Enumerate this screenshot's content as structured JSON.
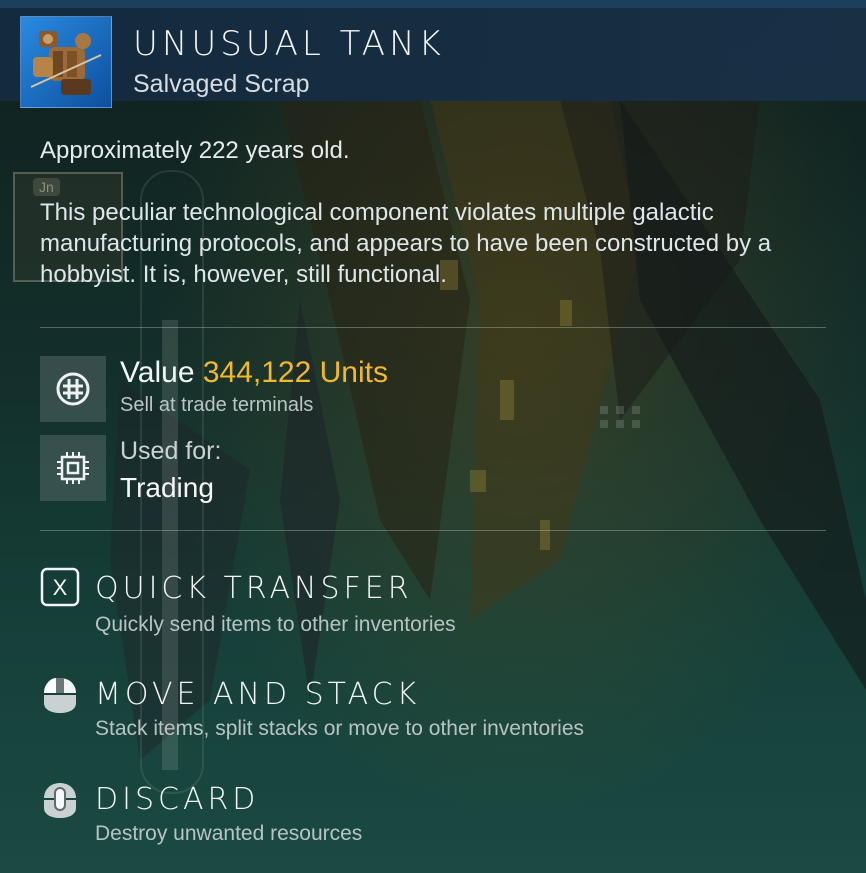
{
  "item": {
    "title": "UNUSUAL TANK",
    "subtitle": "Salvaged Scrap",
    "icon": "salvaged-tank-icon"
  },
  "description": {
    "age_prefix": "Approximately ",
    "age_value": "222",
    "age_suffix": " years old.",
    "text": "This peculiar technological component violates multiple galactic manufacturing protocols, and appears to have been constructed by a hobbyist. It is, however, still functional."
  },
  "value": {
    "label": "Value",
    "amount": "344,122 Units",
    "sub": "Sell at trade terminals",
    "icon": "units-currency-icon"
  },
  "used_for": {
    "label": "Used for:",
    "value": "Trading",
    "icon": "chip-icon"
  },
  "actions": [
    {
      "title": "QUICK TRANSFER",
      "sub": "Quickly send items to other inventories",
      "icon": "x-key-icon",
      "key": "X"
    },
    {
      "title": "MOVE AND STACK",
      "sub": "Stack items, split stacks or move to other inventories",
      "icon": "mouse-left-icon"
    },
    {
      "title": "DISCARD",
      "sub": "Destroy unwanted resources",
      "icon": "mouse-middle-icon"
    }
  ],
  "background": {
    "slot_tag": "Jn"
  },
  "colors": {
    "accent": "#f2b929",
    "header": "#18304a",
    "panel": "#13302c"
  }
}
